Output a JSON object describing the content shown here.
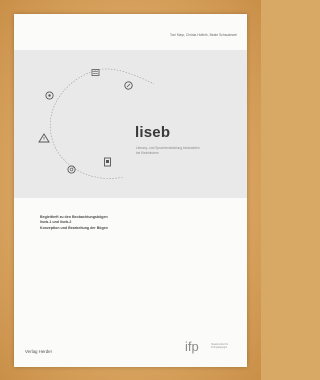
{
  "cover": {
    "authors": "Toni Mayr, Christa Hofbrik, Beate Schaudewel",
    "title": "liseb",
    "subtitle_lines": [
      "Literacy- und Sprachentwicklung beobachten",
      "bei Kleinkindern"
    ],
    "blurb_lines": [
      "Begleitheft zu den Beobachtungsbögen",
      "liseb-1 und liseb-2",
      "Konzeption und Bearbeitung der Bögen"
    ],
    "publisher": "Verlag Herder",
    "logo_text": "ifp",
    "logo_tagline": "Staatsinstitut für Frühpädagogik"
  },
  "colors": {
    "frame": "#d9a561",
    "paper": "#fbfbfa",
    "band": "#e9e9e9",
    "text_dark": "#3a3a3a"
  },
  "icons": [
    "book-icon",
    "pencil-circle-icon",
    "smiley-icon",
    "warning-triangle-icon",
    "face-circle-icon",
    "document-icon"
  ]
}
